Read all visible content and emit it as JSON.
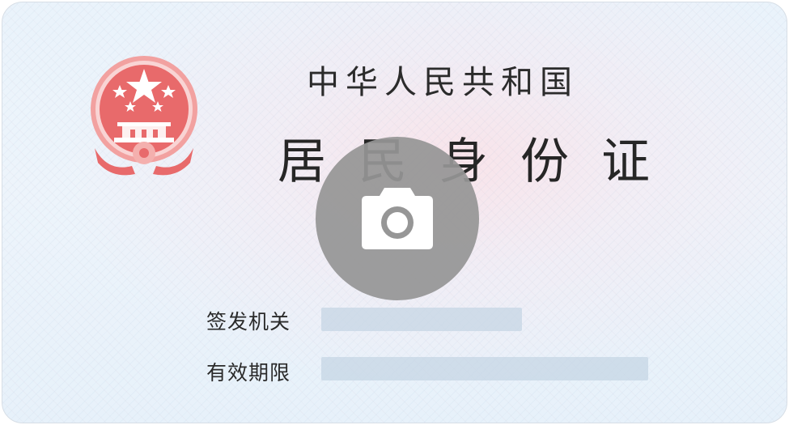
{
  "card": {
    "country_title": "中华人民共和国",
    "document_title": "居民身份证",
    "emblem_icon": "national-emblem-icon",
    "emblem_color": "#e4585c"
  },
  "fields": {
    "issuer_label": "签发机关",
    "validity_label": "有效期限"
  },
  "camera_button": {
    "icon": "camera-icon",
    "color": "#969696"
  }
}
